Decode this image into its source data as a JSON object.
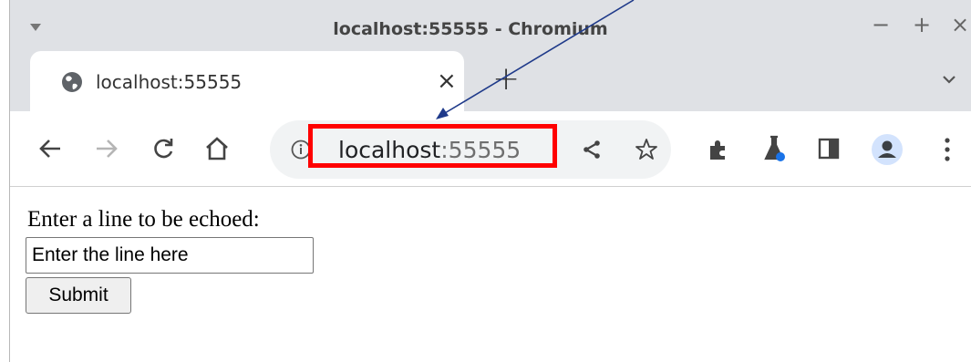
{
  "window": {
    "title": "localhost:55555 - Chromium",
    "controls": [
      "−",
      "+",
      "×"
    ]
  },
  "tab": {
    "title": "localhost:55555",
    "close": "×",
    "new_tab": "+"
  },
  "omnibox": {
    "host": "localhost",
    "port": ":55555"
  },
  "icons": [
    "window-menu-icon",
    "globe-icon",
    "back-icon",
    "forward-icon",
    "reload-icon",
    "home-icon",
    "info-icon",
    "share-icon",
    "bookmark-star-icon",
    "extensions-icon",
    "labs-icon",
    "side-panel-icon",
    "profile-icon",
    "menu-icon",
    "tab-list-icon"
  ],
  "page": {
    "prompt": "Enter a line to be echoed:",
    "input_value": "Enter the line here",
    "submit_label": "Submit"
  },
  "colors": {
    "highlight": "#ff0000",
    "arrow": "#1f3a8a",
    "chrome_frame": "#dfe1e5"
  }
}
